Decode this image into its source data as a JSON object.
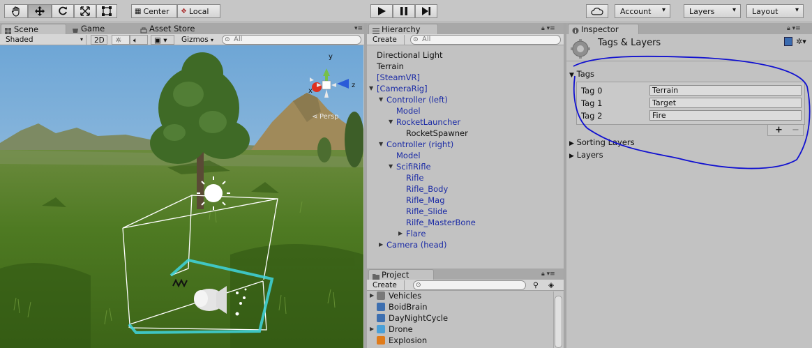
{
  "toolbar": {
    "pivot_label": "Center",
    "space_label": "Local",
    "account_label": "Account",
    "layers_label": "Layers",
    "layout_label": "Layout"
  },
  "scene_panel": {
    "tabs": [
      {
        "label": "Scene",
        "icon": "scene-icon",
        "active": true
      },
      {
        "label": "Game",
        "icon": "game-icon",
        "active": false
      },
      {
        "label": "Asset Store",
        "icon": "asset-store-icon",
        "active": false
      }
    ],
    "shading_mode": "Shaded",
    "mode_2d_label": "2D",
    "gizmos_label": "Gizmos",
    "search_placeholder": "All",
    "gizmo_axes": {
      "x": "x",
      "y": "y",
      "z": "z"
    },
    "projection_label": "Persp",
    "colors": {
      "sky": "#7fb1dc",
      "grass": "#4f7a22",
      "selection": "#ffffff",
      "cyan": "#3fd6e0"
    }
  },
  "hierarchy": {
    "tab_label": "Hierarchy",
    "create_label": "Create",
    "search_placeholder": "All",
    "items": [
      {
        "label": "Directional Light",
        "depth": 0,
        "prefab": false,
        "expander": ""
      },
      {
        "label": "Terrain",
        "depth": 0,
        "prefab": false,
        "expander": ""
      },
      {
        "label": "[SteamVR]",
        "depth": 0,
        "prefab": true,
        "expander": ""
      },
      {
        "label": "[CameraRig]",
        "depth": 0,
        "prefab": true,
        "expander": "open"
      },
      {
        "label": "Controller (left)",
        "depth": 1,
        "prefab": true,
        "expander": "open"
      },
      {
        "label": "Model",
        "depth": 2,
        "prefab": true,
        "expander": ""
      },
      {
        "label": "RocketLauncher",
        "depth": 2,
        "prefab": true,
        "expander": "open"
      },
      {
        "label": "RocketSpawner",
        "depth": 3,
        "prefab": false,
        "expander": ""
      },
      {
        "label": "Controller (right)",
        "depth": 1,
        "prefab": true,
        "expander": "open"
      },
      {
        "label": "Model",
        "depth": 2,
        "prefab": true,
        "expander": ""
      },
      {
        "label": "ScifiRifle",
        "depth": 2,
        "prefab": true,
        "expander": "open"
      },
      {
        "label": "Rifle",
        "depth": 3,
        "prefab": true,
        "expander": ""
      },
      {
        "label": "Rifle_Body",
        "depth": 3,
        "prefab": true,
        "expander": ""
      },
      {
        "label": "Rifle_Mag",
        "depth": 3,
        "prefab": true,
        "expander": ""
      },
      {
        "label": "Rifle_Slide",
        "depth": 3,
        "prefab": true,
        "expander": ""
      },
      {
        "label": "Rilfe_MasterBone",
        "depth": 3,
        "prefab": true,
        "expander": ""
      },
      {
        "label": "Flare",
        "depth": 3,
        "prefab": true,
        "expander": "closed"
      },
      {
        "label": "Camera (head)",
        "depth": 1,
        "prefab": true,
        "expander": "closed"
      }
    ]
  },
  "project": {
    "tab_label": "Project",
    "create_label": "Create",
    "items": [
      {
        "label": "Vehicles",
        "icon": "folder-icon",
        "expander": "closed"
      },
      {
        "label": "BoidBrain",
        "icon": "script-icon",
        "expander": ""
      },
      {
        "label": "DayNightCycle",
        "icon": "script-icon",
        "expander": ""
      },
      {
        "label": "Drone",
        "icon": "prefab-icon",
        "expander": "closed"
      },
      {
        "label": "Explosion",
        "icon": "particle-icon",
        "expander": ""
      }
    ]
  },
  "inspector": {
    "tab_label": "Inspector",
    "title": "Tags & Layers",
    "tags_section": "Tags",
    "tags": [
      {
        "label": "Tag 0",
        "value": "Terrain"
      },
      {
        "label": "Tag 1",
        "value": "Target"
      },
      {
        "label": "Tag 2",
        "value": "Fire"
      }
    ],
    "add_label": "+",
    "remove_label": "−",
    "sorting_layers_label": "Sorting Layers",
    "layers_label": "Layers",
    "annotation_color": "#1010d0"
  }
}
